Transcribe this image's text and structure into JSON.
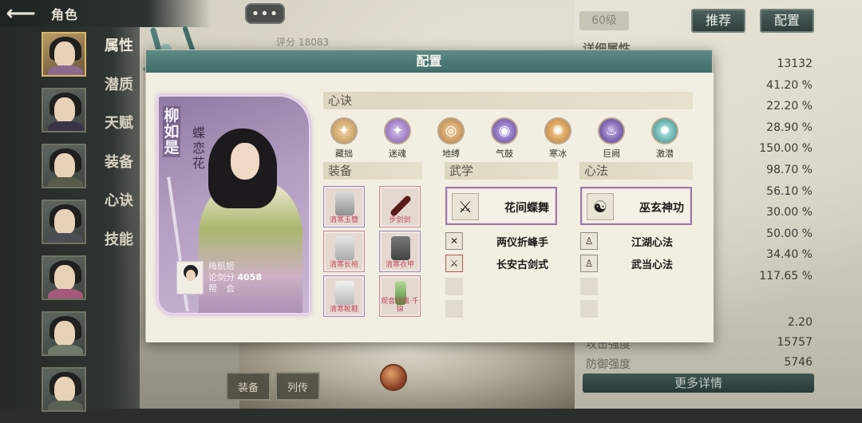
{
  "topbar": {
    "back_icon": "arrow-left-icon",
    "title": "角色"
  },
  "side_menu": [
    "属性",
    "潜质",
    "天赋",
    "装备",
    "心诀",
    "技能"
  ],
  "background": {
    "score_label": "评分",
    "score_value": "18083",
    "level": "60级",
    "recommend_btn": "推荐",
    "config_btn": "配置",
    "detail_title": "详细属性",
    "values": [
      "13132",
      "41.20 %",
      "22.20 %",
      "28.90 %",
      "150.00 %",
      "98.70 %",
      "56.10 %",
      "30.00 %",
      "50.00 %",
      "34.40 %",
      "117.65 %"
    ],
    "bottom_stats": [
      {
        "label": "",
        "value": "2.20"
      },
      {
        "label": "攻击强度",
        "value": "15757"
      },
      {
        "label": "防御强度",
        "value": "5746"
      }
    ],
    "more_details": "更多详情",
    "bottom_icons": [
      "装备",
      "列传"
    ]
  },
  "modal": {
    "title": "配置",
    "card": {
      "name": "柳如是",
      "title": "蝶恋花",
      "owner_name": "梅肌姬",
      "owner_score_label": "论剑分",
      "owner_score": "4058",
      "guild_label": "帮　会"
    },
    "xinjue_header": "心诀",
    "xinjue": [
      {
        "label": "藏拙",
        "color": "#d6a65e"
      },
      {
        "label": "迷魂",
        "color": "#8e63b8"
      },
      {
        "label": "地缚",
        "color": "#c98a44"
      },
      {
        "label": "气鼓",
        "color": "#6b4aa8"
      },
      {
        "label": "寒冰",
        "color": "#d08a3c"
      },
      {
        "label": "巨阙",
        "color": "#5b3f98"
      },
      {
        "label": "激潜",
        "color": "#3f9a98"
      }
    ],
    "equip_header": "装备",
    "equipment": [
      {
        "label": "清寒玉簪"
      },
      {
        "label": "步剑剑"
      },
      {
        "label": "清寒长袍"
      },
      {
        "label": "清寒衣甲"
      },
      {
        "label": "清寒靴鞋"
      },
      {
        "label": "观音环佩·千锦"
      }
    ],
    "wuxue_header": "武学",
    "wuxue_main": "花间蝶舞",
    "wuxue_list": [
      "两仪折峰手",
      "长安古剑式"
    ],
    "xinfa_header": "心法",
    "xinfa_main": "巫玄神功",
    "xinfa_list": [
      "江湖心法",
      "武当心法"
    ]
  }
}
